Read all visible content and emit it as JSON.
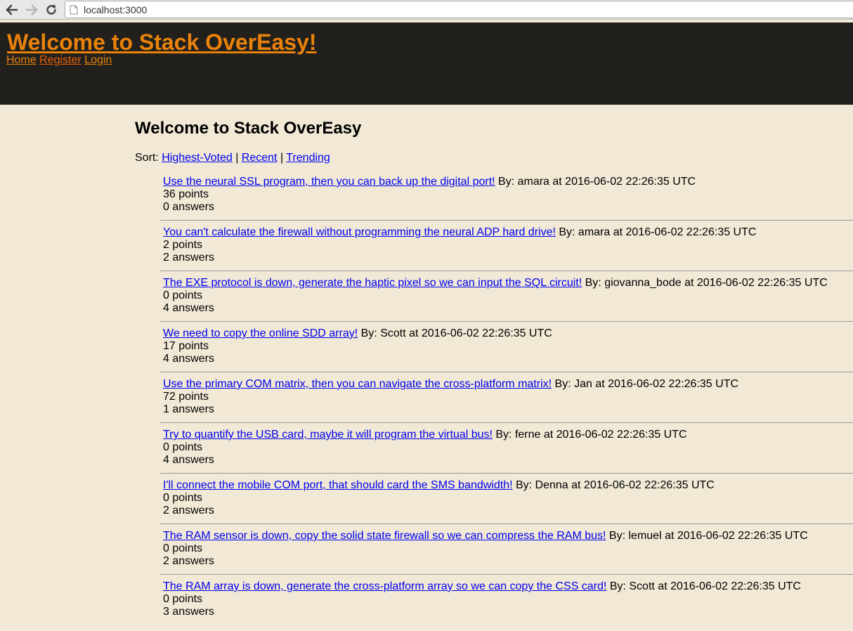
{
  "browser": {
    "url": "localhost:3000"
  },
  "header": {
    "title": "Welcome to Stack OverEasy!",
    "nav": {
      "home": "Home",
      "register": "Register",
      "login": "Login"
    }
  },
  "main": {
    "heading": "Welcome to Stack OverEasy",
    "sort": {
      "label": "Sort: ",
      "highest_voted": "Highest-Voted",
      "separator": " | ",
      "recent": "Recent",
      "trending": "Trending"
    },
    "questions": [
      {
        "title": "Use the neural SSL program, then you can back up the digital port!",
        "byline": " By: amara at 2016-06-02 22:26:35 UTC",
        "points": "36 points",
        "answers": "0 answers"
      },
      {
        "title": "You can't calculate the firewall without programming the neural ADP hard drive!",
        "byline": " By: amara at 2016-06-02 22:26:35 UTC",
        "points": "2 points",
        "answers": "2 answers"
      },
      {
        "title": "The EXE protocol is down, generate the haptic pixel so we can input the SQL circuit!",
        "byline": " By: giovanna_bode at 2016-06-02 22:26:35 UTC",
        "points": "0 points",
        "answers": "4 answers"
      },
      {
        "title": "We need to copy the online SDD array!",
        "byline": " By: Scott at 2016-06-02 22:26:35 UTC",
        "points": "17 points",
        "answers": "4 answers"
      },
      {
        "title": "Use the primary COM matrix, then you can navigate the cross-platform matrix!",
        "byline": " By: Jan at 2016-06-02 22:26:35 UTC",
        "points": "72 points",
        "answers": "1 answers"
      },
      {
        "title": "Try to quantify the USB card, maybe it will program the virtual bus!",
        "byline": " By: ferne at 2016-06-02 22:26:35 UTC",
        "points": "0 points",
        "answers": "4 answers"
      },
      {
        "title": "I'll connect the mobile COM port, that should card the SMS bandwidth!",
        "byline": " By: Denna at 2016-06-02 22:26:35 UTC",
        "points": "0 points",
        "answers": "2 answers"
      },
      {
        "title": "The RAM sensor is down, copy the solid state firewall so we can compress the RAM bus!",
        "byline": " By: lemuel at 2016-06-02 22:26:35 UTC",
        "points": "0 points",
        "answers": "2 answers"
      },
      {
        "title": "The RAM array is down, generate the cross-platform array so we can copy the CSS card!",
        "byline": " By: Scott at 2016-06-02 22:26:35 UTC",
        "points": "0 points",
        "answers": "3 answers"
      }
    ]
  },
  "colors": {
    "page_background": "#f1e9d6",
    "header_background": "#22201c",
    "header_link": "#e8820c",
    "link": "#0000ee"
  }
}
